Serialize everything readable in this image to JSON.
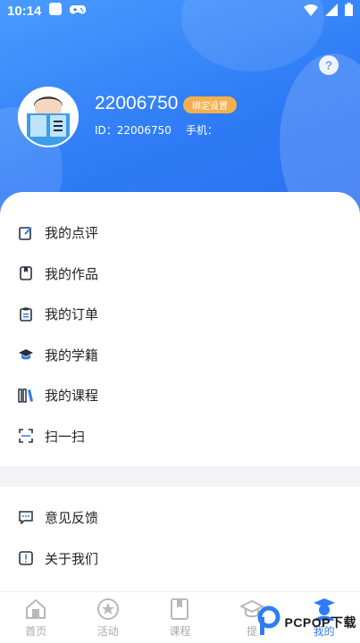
{
  "status_bar": {
    "time": "10:14"
  },
  "profile": {
    "user_number": "22006750",
    "badge": "绑定设置",
    "id_label": "ID：",
    "id_value": "22006750",
    "phone_label": "手机："
  },
  "help": {
    "symbol": "?"
  },
  "menu": [
    {
      "label": "我的点评",
      "icon": "edit-icon"
    },
    {
      "label": "我的作品",
      "icon": "bookmark-icon"
    },
    {
      "label": "我的订单",
      "icon": "clipboard-icon"
    },
    {
      "label": "我的学籍",
      "icon": "graduation-cap-icon"
    },
    {
      "label": "我的课程",
      "icon": "books-icon"
    },
    {
      "label": "扫一扫",
      "icon": "scan-icon"
    }
  ],
  "menu2": [
    {
      "label": "意见反馈",
      "icon": "feedback-icon"
    },
    {
      "label": "关于我们",
      "icon": "info-icon"
    }
  ],
  "tabs": [
    {
      "label": "首页",
      "icon": "home-icon"
    },
    {
      "label": "活动",
      "icon": "star-icon"
    },
    {
      "label": "课程",
      "icon": "book-icon"
    },
    {
      "label": "提",
      "icon": "cap-icon"
    },
    {
      "label": "我的",
      "icon": "user-icon",
      "active": true
    }
  ],
  "watermark": {
    "text": "PCPOP下载"
  },
  "colors": {
    "primary": "#2f7cf6",
    "badge": "#f5b04d"
  }
}
